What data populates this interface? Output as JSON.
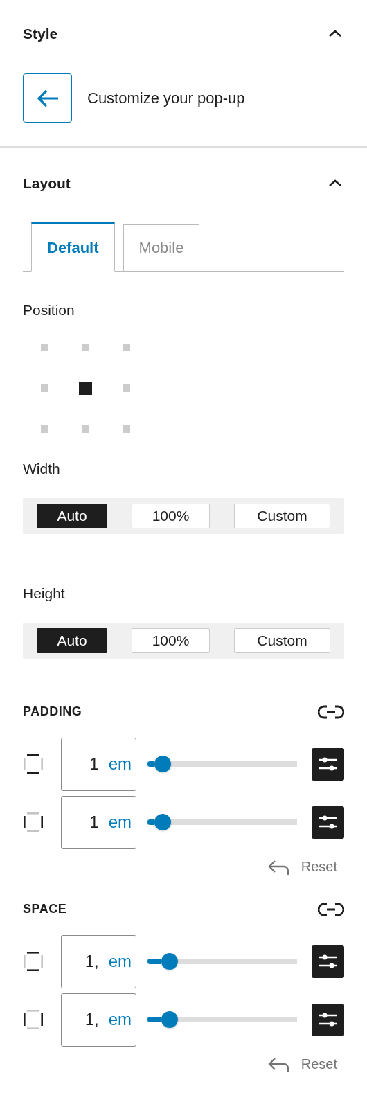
{
  "style_section": {
    "title": "Style",
    "expanded": true,
    "back_label": "Customize your pop-up"
  },
  "layout_section": {
    "title": "Layout",
    "expanded": true,
    "tabs": [
      {
        "label": "Default",
        "selected": true
      },
      {
        "label": "Mobile",
        "selected": false
      }
    ],
    "position": {
      "label": "Position",
      "cells": [
        {
          "selected": false
        },
        {
          "selected": false
        },
        {
          "selected": false
        },
        {
          "selected": false
        },
        {
          "selected": true
        },
        {
          "selected": false
        },
        {
          "selected": false
        },
        {
          "selected": false
        },
        {
          "selected": false
        }
      ]
    },
    "width": {
      "label": "Width",
      "options": [
        {
          "label": "Auto",
          "selected": true
        },
        {
          "label": "100%",
          "selected": false
        },
        {
          "label": "Custom",
          "selected": false
        }
      ]
    },
    "height": {
      "label": "Height",
      "options": [
        {
          "label": "Auto",
          "selected": true
        },
        {
          "label": "100%",
          "selected": false
        },
        {
          "label": "Custom",
          "selected": false
        }
      ]
    },
    "spacing_groups": [
      {
        "title": "PADDING",
        "reset": "Reset",
        "rows": [
          {
            "kind": "vertical",
            "value": "1",
            "unit": "em",
            "level": 0.1
          },
          {
            "kind": "horizontal",
            "value": "1",
            "unit": "em",
            "level": 0.1
          }
        ]
      },
      {
        "title": "SPACE",
        "reset": "Reset",
        "rows": [
          {
            "kind": "vertical",
            "value": "1,",
            "unit": "em",
            "level": 0.15
          },
          {
            "kind": "horizontal",
            "value": "1,",
            "unit": "em",
            "level": 0.15
          }
        ]
      }
    ]
  }
}
